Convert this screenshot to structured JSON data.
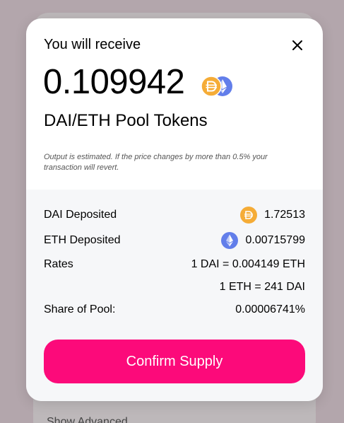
{
  "background": {
    "footer_text": "Show Advanced"
  },
  "modal": {
    "title": "You will receive",
    "close_icon": "close-icon",
    "amount": "0.109942",
    "pool_name": "DAI/ETH Pool Tokens",
    "disclaimer": "Output is estimated. If the price changes by more than 0.5% your transaction will revert.",
    "details": {
      "dai_deposited_label": "DAI Deposited",
      "dai_deposited_value": "1.72513",
      "eth_deposited_label": "ETH Deposited",
      "eth_deposited_value": "0.00715799",
      "rates_label": "Rates",
      "rate_1": "1 DAI = 0.004149 ETH",
      "rate_2": "1 ETH = 241 DAI",
      "share_label": "Share of Pool:",
      "share_value": "0.00006741%"
    },
    "confirm_label": "Confirm Supply"
  },
  "colors": {
    "accent": "#fc0a7a",
    "dai": "#f5ac37",
    "eth": "#627eea",
    "details_bg": "#f6f7f9"
  }
}
